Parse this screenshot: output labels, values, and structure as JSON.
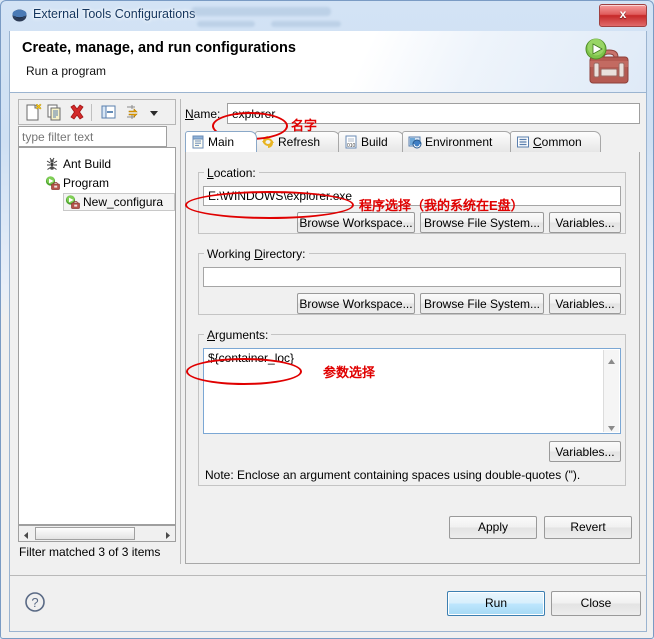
{
  "window": {
    "title": "External Tools Configurations",
    "close_label": "x"
  },
  "header": {
    "title": "Create, manage, and run configurations",
    "subtitle": "Run a program"
  },
  "toolbar": {
    "buttons": [
      {
        "name": "new-configuration-icon",
        "tip": "New launch configuration"
      },
      {
        "name": "duplicate-configuration-icon",
        "tip": "Duplicate"
      },
      {
        "name": "delete-configuration-icon",
        "tip": "Delete"
      },
      {
        "name": "collapse-all-icon",
        "tip": "Collapse All"
      },
      {
        "name": "filter-icon",
        "tip": "Filter"
      },
      {
        "name": "chevron-down-icon",
        "tip": "Menu"
      }
    ]
  },
  "filter": {
    "placeholder": "type filter text",
    "value": "",
    "status": "Filter matched 3 of 3 items"
  },
  "tree": {
    "items": [
      {
        "label": "Ant Build",
        "icon": "ant-icon",
        "indent": 0,
        "selected": false
      },
      {
        "label": "Program",
        "icon": "program-icon",
        "indent": 0,
        "selected": false
      },
      {
        "label": "New_configura",
        "icon": "program-icon",
        "indent": 1,
        "selected": true
      }
    ]
  },
  "name": {
    "label": "Name:",
    "accel": "N",
    "value": "explorer"
  },
  "tabs": [
    {
      "label": "Main",
      "icon": "main-tab-icon",
      "active": true
    },
    {
      "label": "Refresh",
      "icon": "refresh-tab-icon",
      "active": false
    },
    {
      "label": "Build",
      "icon": "build-tab-icon",
      "active": false
    },
    {
      "label": "Environment",
      "icon": "environment-tab-icon",
      "active": false
    },
    {
      "label": "Common",
      "icon": "common-tab-icon",
      "active": false
    }
  ],
  "location": {
    "group_label": "Location:",
    "value": "E:\\WINDOWS\\explorer.exe",
    "browse_workspace": "Browse Workspace...",
    "browse_filesystem": "Browse File System...",
    "variables": "Variables..."
  },
  "working_directory": {
    "group_label": "Working Directory:",
    "value": "",
    "browse_workspace": "Browse Workspace...",
    "browse_filesystem": "Browse File System...",
    "variables": "Variables..."
  },
  "arguments": {
    "group_label": "Arguments:",
    "value": "${container_loc}",
    "variables": "Variables...",
    "note": "Note: Enclose an argument containing spaces using double-quotes (\")."
  },
  "actions": {
    "apply": "Apply",
    "revert": "Revert",
    "run": "Run",
    "close": "Close",
    "help": "?"
  },
  "annotations": [
    {
      "text": "名字",
      "target": "name-field"
    },
    {
      "text": "程序选择（我的系统在E盘）",
      "target": "location-field"
    },
    {
      "text": "参数选择",
      "target": "arguments-field"
    }
  ],
  "colors": {
    "annotation_red": "#e00000",
    "title_text": "#15365e",
    "default_button_blue": "#3c7fb1"
  }
}
